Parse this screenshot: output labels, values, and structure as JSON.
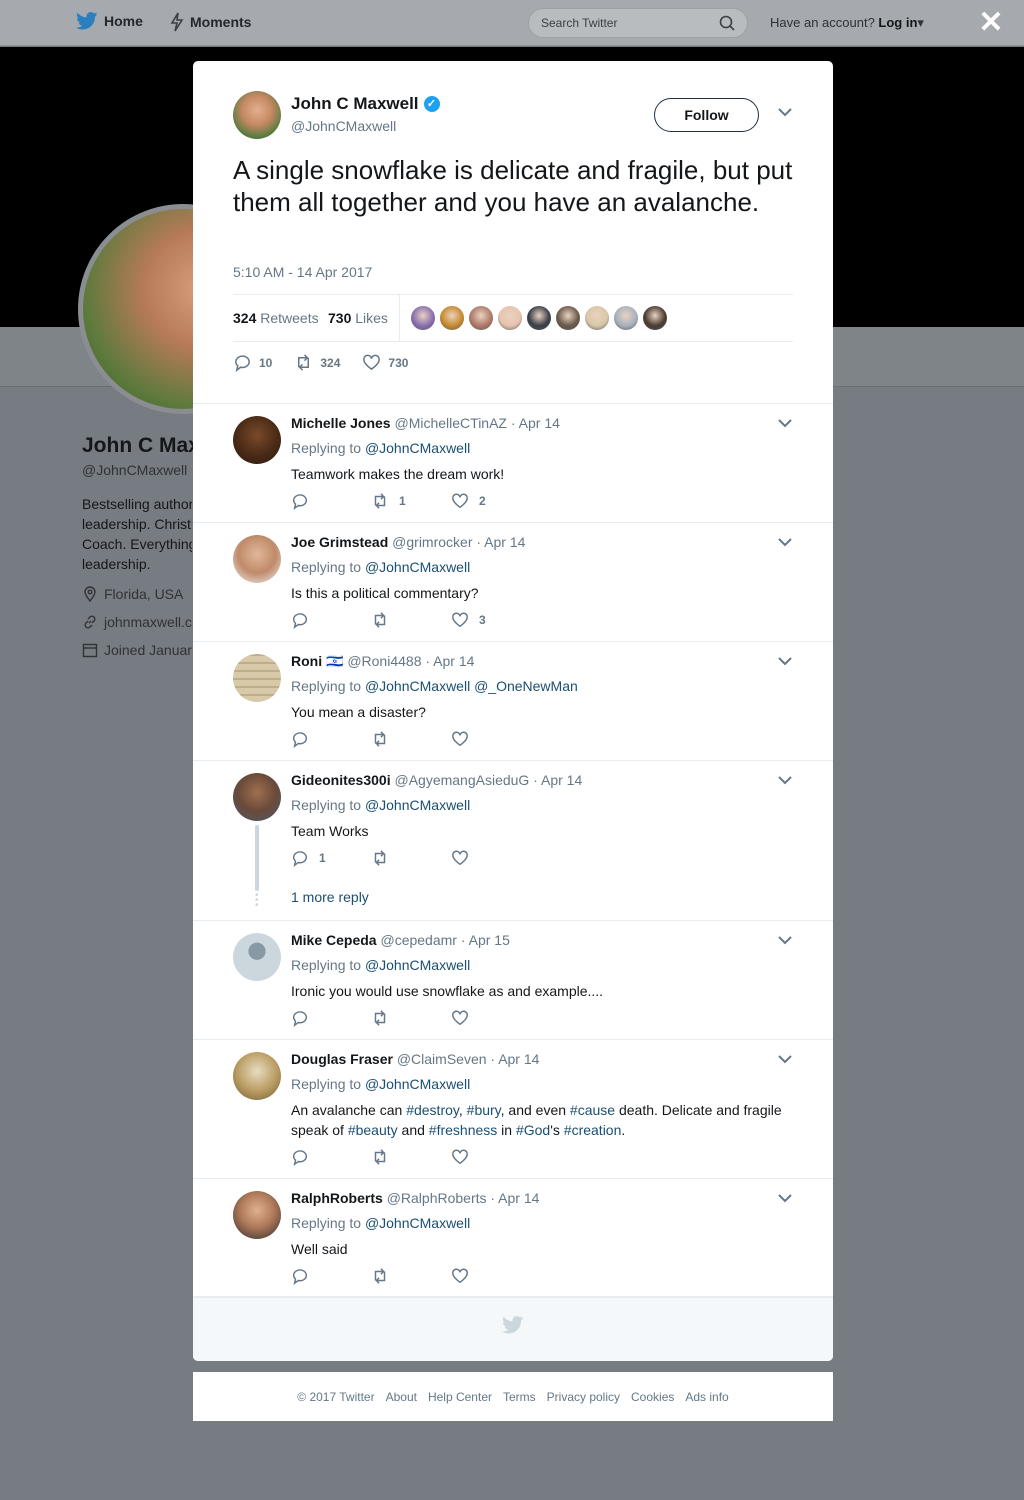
{
  "topbar": {
    "home_label": "Home",
    "moments_label": "Moments",
    "search_placeholder": "Search Twitter",
    "account_prefix": "Have an account?",
    "login_label": "Log in",
    "close_glyph": "✕"
  },
  "background_profile": {
    "name": "John C Max",
    "handle": "@JohnCMaxwell",
    "bio_lines": [
      "Bestselling author",
      "leadership. Christi",
      "Coach. Everything",
      "leadership."
    ],
    "location": "Florida, USA",
    "website": "johnmaxwell.c",
    "joined": "Joined Januar"
  },
  "main_tweet": {
    "author_name": "John C Maxwell",
    "author_handle": "@JohnCMaxwell",
    "follow_label": "Follow",
    "text": "A single snowflake is delicate and fragile, but put them all together and you have an avalanche.",
    "timestamp": "5:10 AM - 14 Apr 2017",
    "retweets_count": "324",
    "retweets_label": "Retweets",
    "likes_count": "730",
    "likes_label": "Likes",
    "reply_count": "10",
    "retweet_count": "324",
    "like_count": "730"
  },
  "likers_colors": [
    "#8a6fb0",
    "#c98a2e",
    "#b07a6a",
    "#e8c4b0",
    "#3a3f48",
    "#6b5a4a",
    "#d8c8a8",
    "#a8b2bd",
    "#4a3a30"
  ],
  "replies": [
    {
      "name": "Michelle Jones",
      "handle": "@MichelleCTinAZ",
      "date": "Apr 14",
      "replying_label": "Replying to",
      "replying_to": "@JohnCMaxwell",
      "text": "Teamwork makes the dream work!",
      "replies": "",
      "retweets": "1",
      "likes": "2"
    },
    {
      "name": "Joe Grimstead",
      "handle": "@grimrocker",
      "date": "Apr 14",
      "replying_label": "Replying to",
      "replying_to": "@JohnCMaxwell",
      "text": "Is this a political commentary?",
      "replies": "",
      "retweets": "",
      "likes": "3"
    },
    {
      "name": "Roni",
      "flag": "🇮🇱",
      "handle": "@Roni4488",
      "date": "Apr 14",
      "replying_label": "Replying to",
      "replying_to": "@JohnCMaxwell @_OneNewMan",
      "text": "You mean a disaster?",
      "replies": "",
      "retweets": "",
      "likes": ""
    },
    {
      "name": "Gideonites300i",
      "handle": "@AgyemangAsieduG",
      "date": "Apr 14",
      "replying_label": "Replying to",
      "replying_to": "@JohnCMaxwell",
      "text": "Team Works",
      "replies": "1",
      "retweets": "",
      "likes": "",
      "more_reply": "1 more reply"
    },
    {
      "name": "Mike Cepeda",
      "handle": "@cepedamr",
      "date": "Apr 15",
      "replying_label": "Replying to",
      "replying_to": "@JohnCMaxwell",
      "text": "Ironic you would use snowflake as and example....",
      "replies": "",
      "retweets": "",
      "likes": ""
    },
    {
      "name": "Douglas Fraser",
      "handle": "@ClaimSeven",
      "date": "Apr 14",
      "replying_label": "Replying to",
      "replying_to": "@JohnCMaxwell",
      "text_parts": {
        "p1": "An avalanche can ",
        "t1": "#destroy",
        "p2": ", ",
        "t2": "#bury",
        "p3": ", and even ",
        "t3": "#cause",
        "p4": " death.  Delicate and fragile speak of ",
        "t4": "#beauty",
        "p5": " and ",
        "t5": "#freshness",
        "p6": " in ",
        "t6": "#God",
        "p7": "'s ",
        "t7": "#creation",
        "p8": "."
      },
      "replies": "",
      "retweets": "",
      "likes": ""
    },
    {
      "name": "RalphRoberts",
      "handle": "@RalphRoberts",
      "date": "Apr 14",
      "replying_label": "Replying to",
      "replying_to": "@JohnCMaxwell",
      "text": "Well said",
      "replies": "",
      "retweets": "",
      "likes": ""
    }
  ],
  "footer": {
    "copyright": "© 2017 Twitter",
    "links": [
      "About",
      "Help Center",
      "Terms",
      "Privacy policy",
      "Cookies",
      "Ads info"
    ]
  },
  "colors": {
    "twitter_blue": "#1da1f2",
    "link_dark": "#1b4f72",
    "muted": "#657786",
    "overlay": "#777c82"
  }
}
